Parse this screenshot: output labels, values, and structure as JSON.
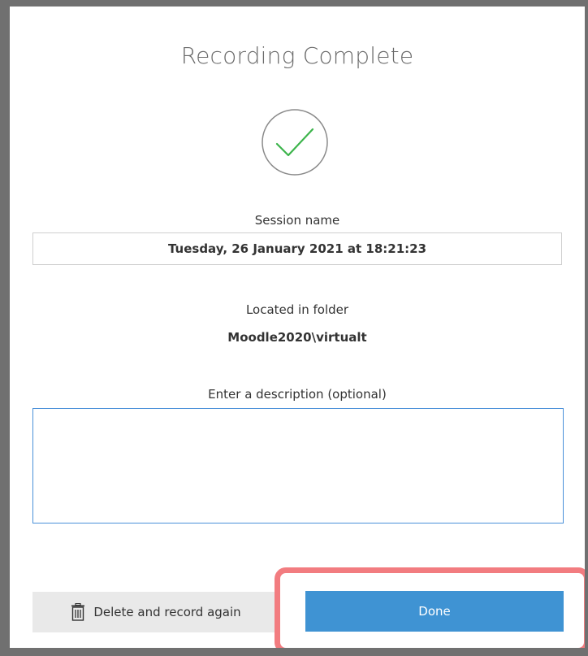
{
  "dialog": {
    "title": "Recording Complete",
    "status_icon": "check-circle-icon",
    "session_label": "Session name",
    "session_value": "Tuesday, 26 January 2021 at 18:21:23",
    "folder_label": "Located in folder",
    "folder_value": "Moodle2020\\virtualt",
    "description_label": "Enter a description (optional)",
    "description_value": ""
  },
  "actions": {
    "delete_label": "Delete and record again",
    "delete_icon": "trash-icon",
    "done_label": "Done"
  },
  "colors": {
    "check_green": "#3cb44b",
    "done_blue": "#3f93d3",
    "highlight_red": "#f27c80",
    "frame_gray": "#707070"
  }
}
